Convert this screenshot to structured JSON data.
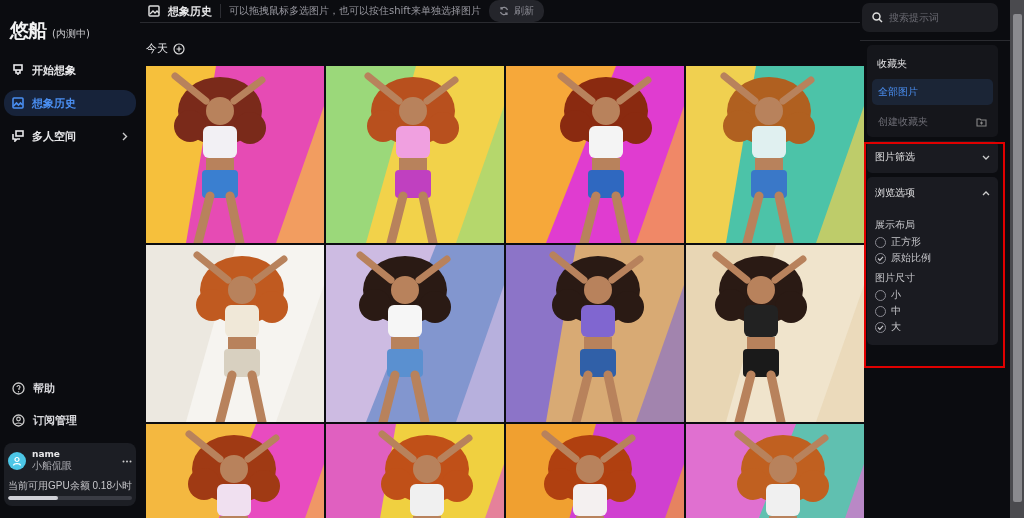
{
  "brand": {
    "logo": "悠船",
    "badge": "(内测中)"
  },
  "nav": [
    {
      "label": "开始想象",
      "selected": false,
      "has_submenu": false
    },
    {
      "label": "想象历史",
      "selected": true,
      "has_submenu": false
    },
    {
      "label": "多人空间",
      "selected": false,
      "has_submenu": true
    }
  ],
  "footer_links": [
    {
      "label": "帮助"
    },
    {
      "label": "订阅管理"
    }
  ],
  "user": {
    "name": "name",
    "subtitle": "小船侃眼",
    "quota_label": "当前可用GPU余额",
    "quota_value": "0.18小时",
    "level": 0.4
  },
  "header": {
    "title": "想象历史",
    "hint": "可以拖拽鼠标多选图片，也可以按住shift来单独选择图片",
    "refresh": "刷新"
  },
  "section": {
    "label": "今天"
  },
  "search": {
    "placeholder": "搜索提示词"
  },
  "collections": {
    "title": "收藏夹",
    "items": [
      {
        "label": "全部图片",
        "selected": true
      }
    ],
    "create": "创建收藏夹"
  },
  "panels": [
    {
      "title": "图片筛选",
      "expanded": false
    },
    {
      "title": "浏览选项",
      "expanded": true,
      "groups": [
        {
          "label": "展示布局",
          "options": [
            {
              "label": "正方形",
              "selected": false
            },
            {
              "label": "原始比例",
              "selected": true
            }
          ]
        },
        {
          "label": "图片尺寸",
          "options": [
            {
              "label": "小",
              "selected": false
            },
            {
              "label": "中",
              "selected": false
            },
            {
              "label": "大",
              "selected": true
            }
          ]
        }
      ]
    }
  ]
}
